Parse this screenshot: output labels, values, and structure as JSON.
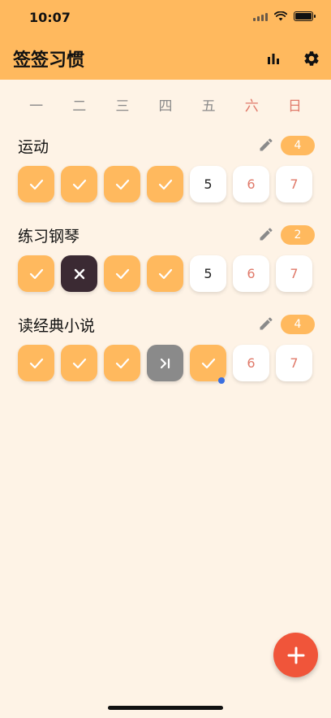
{
  "status_bar": {
    "time": "10:07"
  },
  "app": {
    "title": "签签习惯",
    "accent": "#ffb95e",
    "background": "#fef3e6"
  },
  "header_actions": [
    {
      "name": "statistics",
      "icon": "bar-chart-icon"
    },
    {
      "name": "settings",
      "icon": "gear-icon"
    }
  ],
  "weekdays": [
    {
      "label": "一",
      "weekend": false
    },
    {
      "label": "二",
      "weekend": false
    },
    {
      "label": "三",
      "weekend": false
    },
    {
      "label": "四",
      "weekend": false
    },
    {
      "label": "五",
      "weekend": false
    },
    {
      "label": "六",
      "weekend": true
    },
    {
      "label": "日",
      "weekend": true
    }
  ],
  "habits": [
    {
      "name": "运动",
      "count": "4",
      "days": [
        {
          "state": "done"
        },
        {
          "state": "done"
        },
        {
          "state": "done"
        },
        {
          "state": "done"
        },
        {
          "state": "todo",
          "label": "5"
        },
        {
          "state": "todo",
          "label": "6",
          "weekend": true
        },
        {
          "state": "todo",
          "label": "7",
          "weekend": true
        }
      ]
    },
    {
      "name": "练习钢琴",
      "count": "2",
      "days": [
        {
          "state": "done"
        },
        {
          "state": "fail"
        },
        {
          "state": "done"
        },
        {
          "state": "done"
        },
        {
          "state": "todo",
          "label": "5"
        },
        {
          "state": "todo",
          "label": "6",
          "weekend": true
        },
        {
          "state": "todo",
          "label": "7",
          "weekend": true
        }
      ]
    },
    {
      "name": "读经典小说",
      "count": "4",
      "days": [
        {
          "state": "done"
        },
        {
          "state": "done"
        },
        {
          "state": "done"
        },
        {
          "state": "skip"
        },
        {
          "state": "done",
          "today": true
        },
        {
          "state": "todo",
          "label": "6",
          "weekend": true
        },
        {
          "state": "todo",
          "label": "7",
          "weekend": true
        }
      ]
    }
  ],
  "fab": {
    "icon": "plus-icon",
    "color": "#f0553a"
  }
}
